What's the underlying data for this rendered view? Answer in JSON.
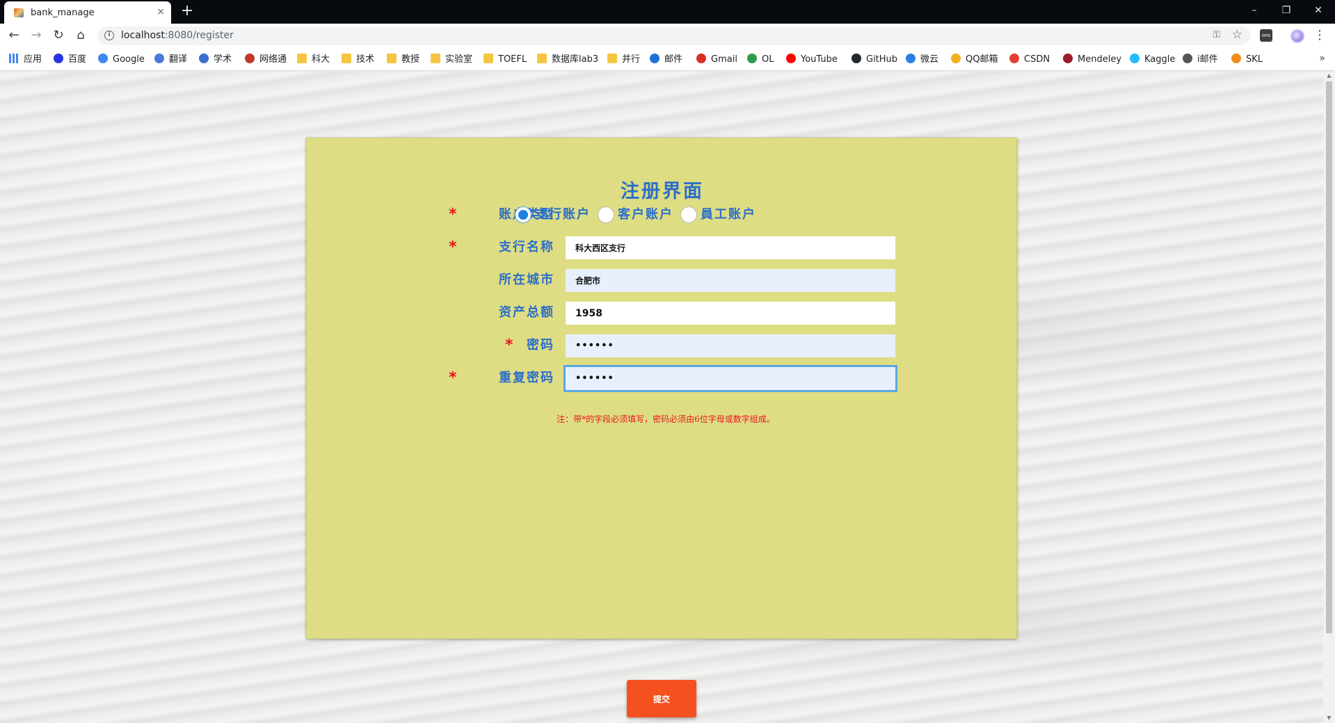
{
  "browser": {
    "tab_title": "bank_manage",
    "tab_close": "×",
    "new_tab": "+",
    "url_host": "localhost",
    "url_path": ":8080/register",
    "window_minimize": "–",
    "window_restore": "❐",
    "window_close": "✕",
    "back": "←",
    "forward": "→",
    "reload": "↻",
    "home": "⌂",
    "star": "☆",
    "key": "⚿",
    "menu": "⋮",
    "ext_label": "ons",
    "bookmarks_more": "»"
  },
  "bookmarks": [
    {
      "label": "应用",
      "icon": "apps-icon",
      "color": "#4285f4"
    },
    {
      "label": "百度",
      "icon": "baidu-icon",
      "color": "#2932e1"
    },
    {
      "label": "Google",
      "icon": "google-icon",
      "color": "#4285f4"
    },
    {
      "label": "翻译",
      "icon": "translate-icon",
      "color": "#4a78d6"
    },
    {
      "label": "学术",
      "icon": "scholar-icon",
      "color": "#3b6fd1"
    },
    {
      "label": "网络通",
      "icon": "network-icon",
      "color": "#c0392b"
    },
    {
      "label": "科大",
      "icon": "folder-icon",
      "color": "#f5c542"
    },
    {
      "label": "技术",
      "icon": "folder-icon",
      "color": "#f5c542"
    },
    {
      "label": "教授",
      "icon": "folder-icon",
      "color": "#f5c542"
    },
    {
      "label": "实验室",
      "icon": "folder-icon",
      "color": "#f5c542"
    },
    {
      "label": "TOEFL",
      "icon": "folder-icon",
      "color": "#f5c542"
    },
    {
      "label": "数据库lab3",
      "icon": "folder-icon",
      "color": "#f5c542"
    },
    {
      "label": "并行",
      "icon": "folder-icon",
      "color": "#f5c542"
    },
    {
      "label": "邮件",
      "icon": "mail-c-icon",
      "color": "#1e6fd9"
    },
    {
      "label": "Gmail",
      "icon": "gmail-icon",
      "color": "#d93025"
    },
    {
      "label": "OL",
      "icon": "ol-icon",
      "color": "#2e9c4a"
    },
    {
      "label": "YouTube",
      "icon": "youtube-icon",
      "color": "#ff0000"
    },
    {
      "label": "GitHub",
      "icon": "github-icon",
      "color": "#24292e"
    },
    {
      "label": "微云",
      "icon": "weiyun-icon",
      "color": "#2f7ee6"
    },
    {
      "label": "QQ邮箱",
      "icon": "qqmail-icon",
      "color": "#f2b01e"
    },
    {
      "label": "CSDN",
      "icon": "csdn-icon",
      "color": "#e33e33"
    },
    {
      "label": "Mendeley",
      "icon": "mendeley-icon",
      "color": "#9c1e2a"
    },
    {
      "label": "Kaggle",
      "icon": "kaggle-icon",
      "color": "#20beff"
    },
    {
      "label": "i邮件",
      "icon": "apple-icon",
      "color": "#555555"
    },
    {
      "label": "SKL",
      "icon": "skl-icon",
      "color": "#f08c1e"
    }
  ],
  "form": {
    "title": "注册界面",
    "required_mark": "*",
    "account_type": {
      "label": "账户类型",
      "options": [
        "支行账户",
        "客户账户",
        "員工账户"
      ],
      "selected": "支行账户"
    },
    "branch_name": {
      "label": "支行名称",
      "value": "科大西区支行"
    },
    "city": {
      "label": "所在城市",
      "value": "合肥市"
    },
    "assets": {
      "label": "资产总额",
      "value": "1958"
    },
    "password": {
      "label": "密码",
      "value": "••••••"
    },
    "password_repeat": {
      "label": "重复密码",
      "value": "••••••"
    },
    "note": "注：带*的字段必须填写，密码必须由6位字母或数字组成。",
    "submit_label": "提交"
  },
  "colors": {
    "card_bg": "#dedd84",
    "label_blue": "#2c6fc9",
    "required_red": "#e8141b",
    "submit_orange": "#f4511e"
  }
}
